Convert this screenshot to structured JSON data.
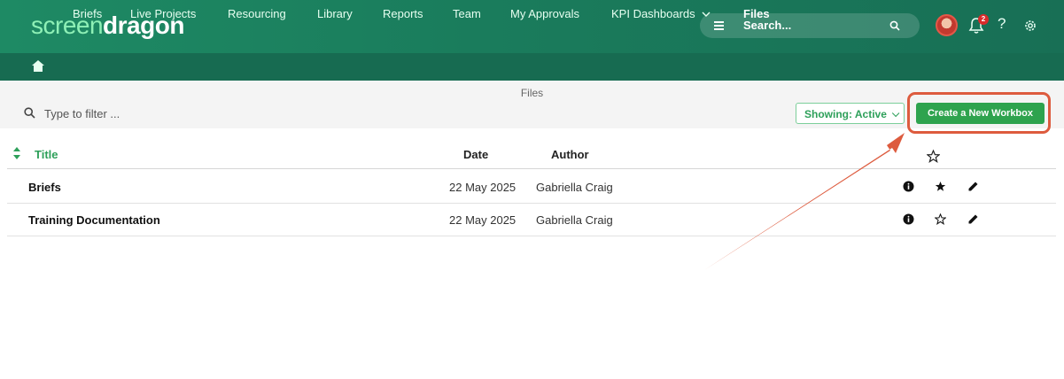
{
  "header": {
    "logo_light": "screen",
    "logo_bold": "dragon",
    "search_label": "Search...",
    "notification_count": "2",
    "help_label": "?"
  },
  "nav": {
    "items": [
      "Briefs",
      "Live Projects",
      "Resourcing",
      "Library",
      "Reports",
      "Team",
      "My Approvals",
      "KPI Dashboards",
      "Files"
    ],
    "active": "Files"
  },
  "toolbar": {
    "page_label": "Files",
    "filter_placeholder": "Type to filter ...",
    "showing_label": "Showing: Active",
    "create_label": "Create a New Workbox"
  },
  "table": {
    "columns": [
      "Title",
      "Date",
      "Author"
    ],
    "rows": [
      {
        "title": "Briefs",
        "date": "22 May 2025",
        "author": "Gabriella Craig",
        "starred": true
      },
      {
        "title": "Training Documentation",
        "date": "22 May 2025",
        "author": "Gabriella Craig",
        "starred": false
      }
    ]
  },
  "colors": {
    "brand_green": "#1a7c5c",
    "accent_green": "#2ea05a",
    "button_green": "#2ea34e",
    "annotation_red": "#dd5b3e"
  }
}
